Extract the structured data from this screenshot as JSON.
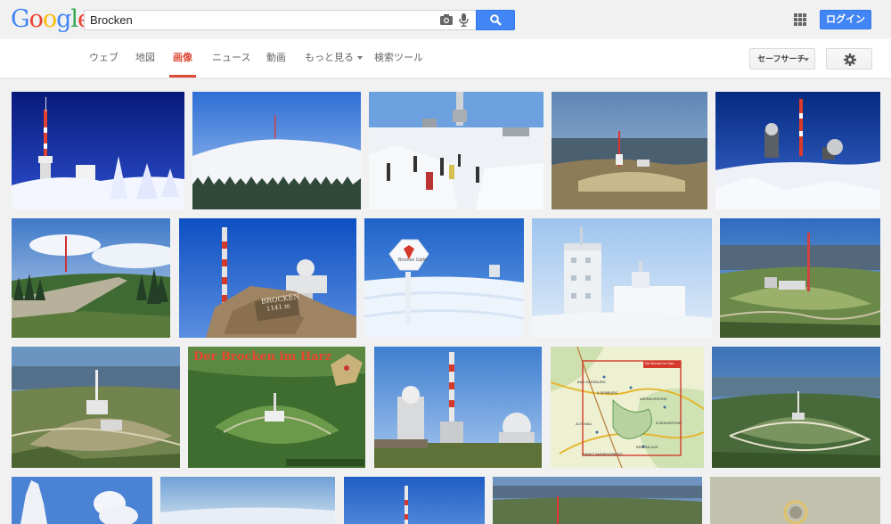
{
  "logo": {
    "letters": [
      "G",
      "o",
      "o",
      "g",
      "l",
      "e"
    ],
    "colors": [
      "#4285f4",
      "#ea4335",
      "#fbbc05",
      "#4285f4",
      "#34a853",
      "#ea4335"
    ]
  },
  "search": {
    "value": "Brocken"
  },
  "header": {
    "login_label": "ログイン"
  },
  "tabs": [
    {
      "label": "ウェブ",
      "active": false
    },
    {
      "label": "地図",
      "active": false
    },
    {
      "label": "画像",
      "active": true
    },
    {
      "label": "ニュース",
      "active": false
    },
    {
      "label": "動画",
      "active": false
    },
    {
      "label": "もっと見る",
      "active": false,
      "dropdown": true
    },
    {
      "label": "検索ツール",
      "active": false
    }
  ],
  "toolbar": {
    "safesearch_label": "セーフサーチ"
  },
  "captions": {
    "harz_title": "Der Brocken im Harz",
    "sign_name": "BROCKEN",
    "sign_height": "1141 m",
    "boardsign": "Brocken Gipfel",
    "map_region": "Der Brocken im Harz",
    "map_towns": [
      "BAD HARZBURG",
      "ILSENBURG",
      "WERNIGERODE",
      "ELBINGERODE",
      "ALTENAU",
      "BRAUNLAGE",
      "SANKT ANDREASBERG"
    ]
  },
  "colors": {
    "accent_blue": "#4285f4",
    "active_tab": "#dd4b39"
  }
}
